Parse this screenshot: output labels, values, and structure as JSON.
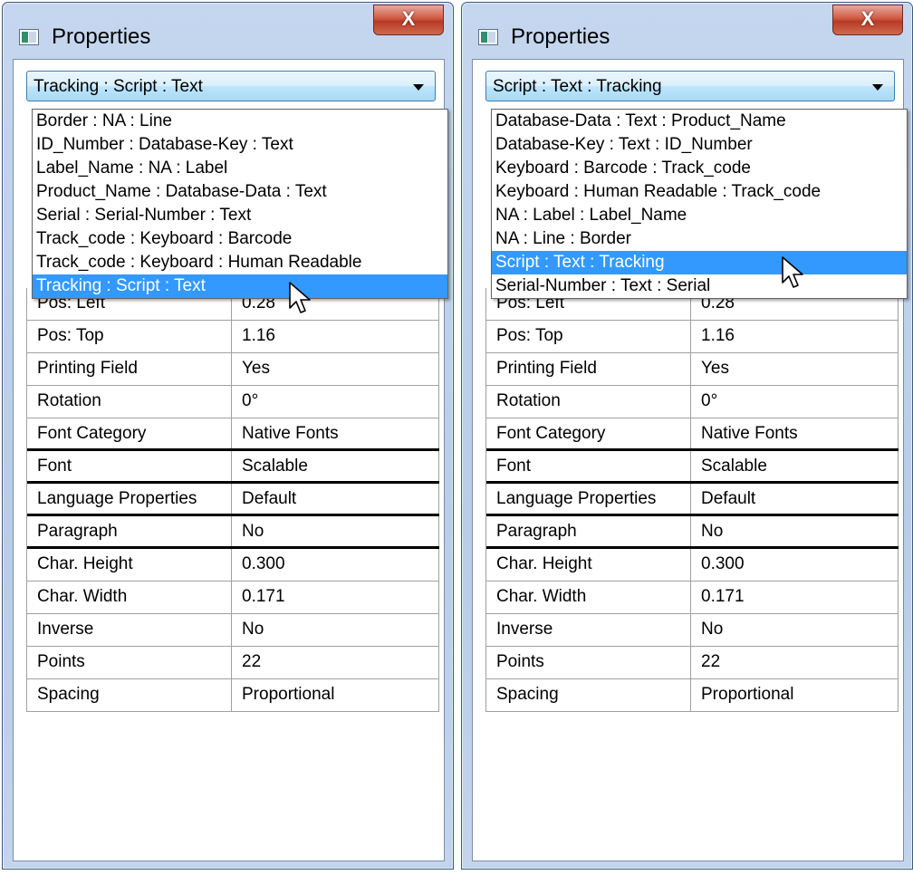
{
  "windows": [
    {
      "title": "Properties",
      "close_label": "X",
      "combo_value": "Tracking : Script : Text",
      "dropdown_items": [
        {
          "label": "Border : NA : Line"
        },
        {
          "label": "ID_Number : Database-Key : Text"
        },
        {
          "label": "Label_Name : NA : Label"
        },
        {
          "label": "Product_Name : Database-Data : Text"
        },
        {
          "label": "Serial : Serial-Number : Text"
        },
        {
          "label": "Track_code : Keyboard : Barcode"
        },
        {
          "label": "Track_code : Keyboard : Human Readable"
        },
        {
          "label": "Tracking : Script : Text",
          "selected": true
        }
      ],
      "partial_row": {
        "name": "Pos: Left",
        "value": "0.28"
      },
      "rows": [
        {
          "name": "Pos: Top",
          "value": "1.16"
        },
        {
          "name": "Printing Field",
          "value": "Yes"
        },
        {
          "name": "Rotation",
          "value": "0°"
        },
        {
          "name": "Font Category",
          "value": "Native Fonts"
        },
        {
          "name": "Font",
          "value": "Scalable"
        },
        {
          "name": "Language Properties",
          "value": "Default"
        },
        {
          "name": "Paragraph",
          "value": "No"
        },
        {
          "name": "Char. Height",
          "value": "0.300"
        },
        {
          "name": "Char. Width",
          "value": "0.171"
        },
        {
          "name": "Inverse",
          "value": "No"
        },
        {
          "name": "Points",
          "value": "22"
        },
        {
          "name": "Spacing",
          "value": "Proportional"
        }
      ]
    },
    {
      "title": "Properties",
      "close_label": "X",
      "combo_value": "Script : Text : Tracking",
      "dropdown_items": [
        {
          "label": "Database-Data : Text : Product_Name"
        },
        {
          "label": "Database-Key : Text : ID_Number"
        },
        {
          "label": "Keyboard : Barcode : Track_code"
        },
        {
          "label": "Keyboard : Human Readable : Track_code"
        },
        {
          "label": "NA : Label : Label_Name"
        },
        {
          "label": "NA : Line : Border"
        },
        {
          "label": "Script : Text : Tracking",
          "selected": true
        },
        {
          "label": "Serial-Number : Text : Serial"
        }
      ],
      "partial_row": {
        "name": "Pos: Left",
        "value": "0.28"
      },
      "rows": [
        {
          "name": "Pos: Top",
          "value": "1.16"
        },
        {
          "name": "Printing Field",
          "value": "Yes"
        },
        {
          "name": "Rotation",
          "value": "0°"
        },
        {
          "name": "Font Category",
          "value": "Native Fonts"
        },
        {
          "name": "Font",
          "value": "Scalable"
        },
        {
          "name": "Language Properties",
          "value": "Default"
        },
        {
          "name": "Paragraph",
          "value": "No"
        },
        {
          "name": "Char. Height",
          "value": "0.300"
        },
        {
          "name": "Char. Width",
          "value": "0.171"
        },
        {
          "name": "Inverse",
          "value": "No"
        },
        {
          "name": "Points",
          "value": "22"
        },
        {
          "name": "Spacing",
          "value": "Proportional"
        }
      ]
    }
  ],
  "colors": {
    "selection": "#3399ff",
    "frame": "#b9cde8",
    "close_button": "#c44a32"
  },
  "icons": [
    "app-icon",
    "close-icon",
    "chevron-down-icon",
    "mouse-pointer-icon"
  ]
}
